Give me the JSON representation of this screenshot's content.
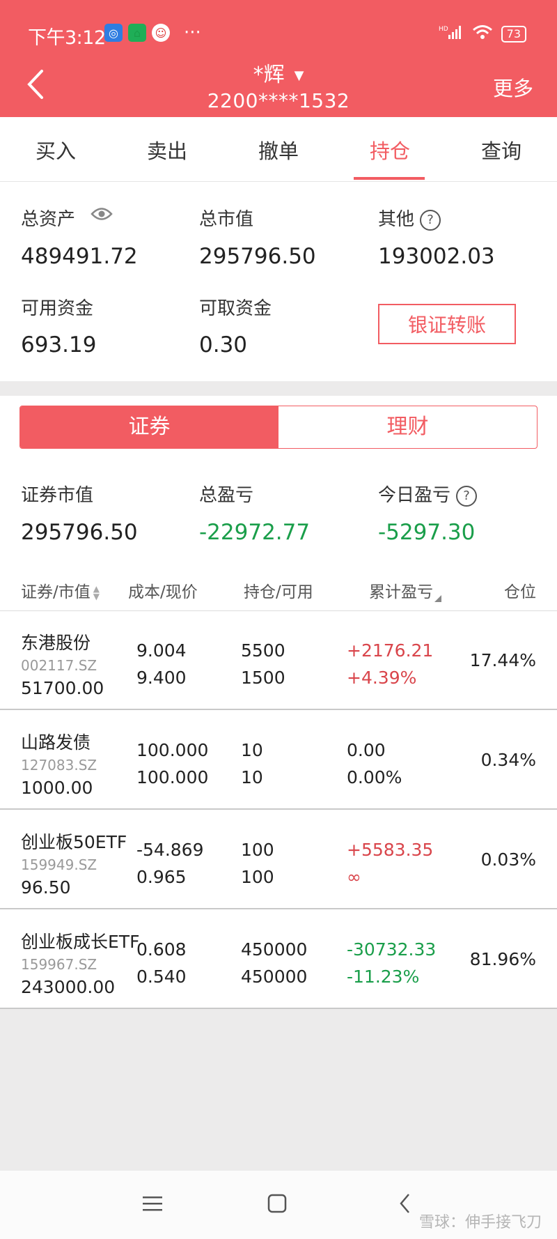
{
  "status_bar": {
    "time": "下午3:12",
    "dots": "···",
    "network": "HD",
    "battery": "73"
  },
  "header": {
    "name": "*辉",
    "account": "2200****1532",
    "more_label": "更多"
  },
  "tabs": [
    {
      "label": "买入",
      "active": false
    },
    {
      "label": "卖出",
      "active": false
    },
    {
      "label": "撤单",
      "active": false
    },
    {
      "label": "持仓",
      "active": true
    },
    {
      "label": "查询",
      "active": false
    }
  ],
  "assets": {
    "total_assets_label": "总资产",
    "total_assets_value": "489491.72",
    "market_value_label": "总市值",
    "market_value_value": "295796.50",
    "other_label": "其他",
    "other_value": "193002.03",
    "available_label": "可用资金",
    "available_value": "693.19",
    "withdrawable_label": "可取资金",
    "withdrawable_value": "0.30",
    "transfer_button": "银证转账"
  },
  "segment": {
    "securities": "证券",
    "wealth": "理财"
  },
  "summary": {
    "sec_value_label": "证券市值",
    "sec_value": "295796.50",
    "total_pl_label": "总盈亏",
    "total_pl": "-22972.77",
    "today_pl_label": "今日盈亏",
    "today_pl": "-5297.30"
  },
  "columns": {
    "security": "证券/市值",
    "cost": "成本/现价",
    "position": "持仓/可用",
    "pl": "累计盈亏",
    "weight": "仓位"
  },
  "holdings": [
    {
      "name": "东港股份",
      "code": "002117.SZ",
      "market_value": "51700.00",
      "cost": "9.004",
      "price": "9.400",
      "position": "5500",
      "available": "1500",
      "pl": "+2176.21",
      "pl_pct": "+4.39%",
      "weight": "17.44%",
      "trend": "up"
    },
    {
      "name": "山路发债",
      "code": "127083.SZ",
      "market_value": "1000.00",
      "cost": "100.000",
      "price": "100.000",
      "position": "10",
      "available": "10",
      "pl": "0.00",
      "pl_pct": "0.00%",
      "weight": "0.34%",
      "trend": "flat"
    },
    {
      "name": "创业板50ETF",
      "code": "159949.SZ",
      "market_value": "96.50",
      "cost": "-54.869",
      "price": "0.965",
      "position": "100",
      "available": "100",
      "pl": "+5583.35",
      "pl_pct": "∞",
      "weight": "0.03%",
      "trend": "up"
    },
    {
      "name": "创业板成长ETF",
      "code": "159967.SZ",
      "market_value": "243000.00",
      "cost": "0.608",
      "price": "0.540",
      "position": "450000",
      "available": "450000",
      "pl": "-30732.33",
      "pl_pct": "-11.23%",
      "weight": "81.96%",
      "trend": "down"
    }
  ],
  "watermark": "雪球：伸手接飞刀",
  "colors": {
    "brand": "#f25c62",
    "up": "#d9454b",
    "down": "#1a9e4a"
  }
}
